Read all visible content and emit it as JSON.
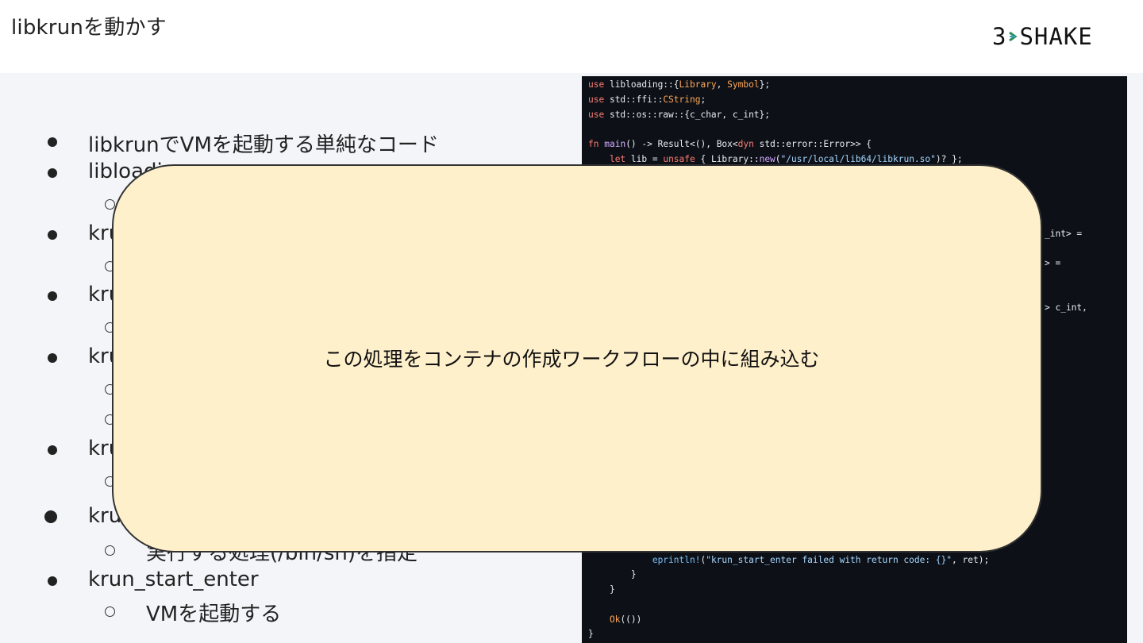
{
  "slide": {
    "title": "libkrunを動かす"
  },
  "logo": {
    "text_left": "3",
    "text_right": "SHAKE",
    "accent": "#2d8f5a",
    "accent2": "#3ba3c8"
  },
  "bullets": [
    {
      "level": 1,
      "text": "libkrunでVMを起動する単純なコード"
    },
    {
      "level": 1,
      "text": "libloadi"
    },
    {
      "level": 2,
      "text": ""
    },
    {
      "level": 1,
      "text": "kru"
    },
    {
      "level": 2,
      "text": ""
    },
    {
      "level": 1,
      "text": "kru"
    },
    {
      "level": 2,
      "text": ""
    },
    {
      "level": 1,
      "text": "kru"
    },
    {
      "level": 2,
      "text": ""
    },
    {
      "level": 2,
      "text": ""
    },
    {
      "level": 1,
      "text": "kru"
    },
    {
      "level": 2,
      "text": ""
    },
    {
      "level": 1,
      "text": "kru"
    },
    {
      "level": 2,
      "text": "実行する処理(/bin/sh)を指定"
    },
    {
      "level": 1,
      "text": "krun_start_enter"
    },
    {
      "level": 2,
      "text": "VMを起動する"
    }
  ],
  "code": {
    "lines": [
      "use libloading::{Library, Symbol};",
      "use std::ffi::CString;",
      "use std::os::raw::{c_char, c_int};",
      "fn main() -> Result<(), Box<dyn std::error::Error>> {",
      "    let lib = unsafe { Library::new(\"/usr/local/lib64/libkrun.so\")? };",
      "_int> =",
      "> =",
      "> c_int,",
      "            eprintln!(\"krun_start_enter failed with return code: {}\", ret);",
      "        }",
      "    }",
      "    Ok(())",
      "}"
    ]
  },
  "overlay": {
    "text": "この処理をコンテナの作成ワークフローの中に組み込む"
  }
}
